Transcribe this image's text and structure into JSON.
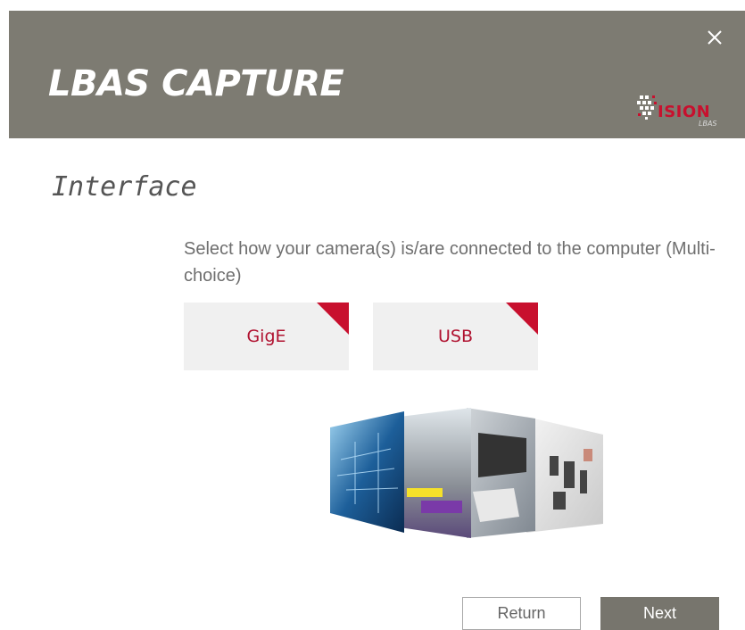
{
  "header": {
    "title": "LBAS CAPTURE",
    "close_icon": "close-icon",
    "logo": {
      "name": "vision-lbas-logo",
      "word": "ISION",
      "sub": "LBAS"
    },
    "background_color": "#7d7b72"
  },
  "section": {
    "title": "Interface",
    "instruction": "Select how your camera(s) is/are connected to the computer (Multi-choice)"
  },
  "choices": [
    {
      "label": "GigE",
      "selected": true
    },
    {
      "label": "USB",
      "selected": true
    }
  ],
  "accent_color": "#c8102e",
  "buttons": {
    "return_label": "Return",
    "next_label": "Next"
  }
}
